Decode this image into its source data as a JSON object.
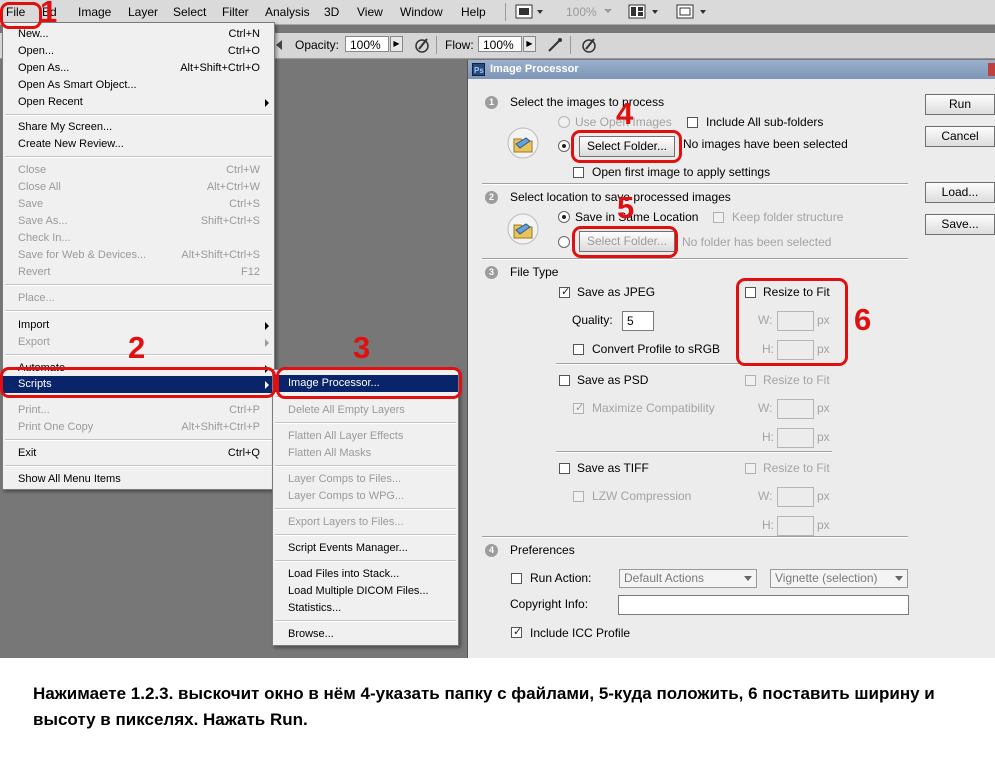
{
  "menubar": {
    "items": [
      "File",
      "Ed",
      "Image",
      "Layer",
      "Select",
      "Filter",
      "Analysis",
      "3D",
      "View",
      "Window",
      "Help"
    ],
    "zoom": "100%"
  },
  "options_bar": {
    "opacity_label": "Opacity:",
    "opacity_value": "100%",
    "flow_label": "Flow:",
    "flow_value": "100%"
  },
  "file_menu": {
    "items": [
      {
        "label": "New...",
        "shortcut": "Ctrl+N"
      },
      {
        "label": "Open...",
        "shortcut": "Ctrl+O"
      },
      {
        "label": "Open As...",
        "shortcut": "Alt+Shift+Ctrl+O"
      },
      {
        "label": "Open As Smart Object...",
        "shortcut": ""
      },
      {
        "label": "Open Recent",
        "shortcut": ""
      },
      {
        "label": "Share My Screen...",
        "shortcut": ""
      },
      {
        "label": "Create New Review...",
        "shortcut": ""
      },
      {
        "label": "Close",
        "shortcut": "Ctrl+W"
      },
      {
        "label": "Close All",
        "shortcut": "Alt+Ctrl+W"
      },
      {
        "label": "Save",
        "shortcut": "Ctrl+S"
      },
      {
        "label": "Save As...",
        "shortcut": "Shift+Ctrl+S"
      },
      {
        "label": "Check In...",
        "shortcut": ""
      },
      {
        "label": "Save for Web & Devices...",
        "shortcut": "Alt+Shift+Ctrl+S"
      },
      {
        "label": "Revert",
        "shortcut": "F12"
      },
      {
        "label": "Place...",
        "shortcut": ""
      },
      {
        "label": "Import",
        "shortcut": ""
      },
      {
        "label": "Export",
        "shortcut": ""
      },
      {
        "label": "Automate",
        "shortcut": ""
      },
      {
        "label": "Scripts",
        "shortcut": ""
      },
      {
        "label": "Print...",
        "shortcut": "Ctrl+P"
      },
      {
        "label": "Print One Copy",
        "shortcut": "Alt+Shift+Ctrl+P"
      },
      {
        "label": "Exit",
        "shortcut": "Ctrl+Q"
      },
      {
        "label": "Show All Menu Items",
        "shortcut": ""
      }
    ]
  },
  "scripts_menu": {
    "items": [
      "Image Processor...",
      "Delete All Empty Layers",
      "Flatten All Layer Effects",
      "Flatten All Masks",
      "Layer Comps to Files...",
      "Layer Comps to WPG...",
      "Export Layers to Files...",
      "Script Events Manager...",
      "Load Files into Stack...",
      "Load Multiple DICOM Files...",
      "Statistics...",
      "Browse..."
    ]
  },
  "dialog": {
    "title": "Image Processor",
    "buttons": {
      "run": "Run",
      "cancel": "Cancel",
      "load": "Load...",
      "save": "Save..."
    },
    "section1": {
      "num": "1",
      "title": "Select the images to process",
      "use_open": "Use Open Images",
      "include_sub": "Include All sub-folders",
      "select_folder": "Select Folder...",
      "status": "No images have been selected",
      "open_first": "Open first image to apply settings"
    },
    "section2": {
      "num": "2",
      "title": "Select location to save processed images",
      "same_location": "Save in Same Location",
      "keep_structure": "Keep folder structure",
      "select_folder": "Select Folder...",
      "status": "No folder has been selected"
    },
    "section3": {
      "num": "3",
      "title": "File Type",
      "jpeg": "Save as JPEG",
      "resize": "Resize to Fit",
      "quality_label": "Quality:",
      "quality_value": "5",
      "w_label": "W:",
      "h_label": "H:",
      "px": "px",
      "srgb": "Convert Profile to sRGB",
      "psd": "Save as PSD",
      "max_compat": "Maximize Compatibility",
      "tiff": "Save as TIFF",
      "lzw": "LZW Compression"
    },
    "section4": {
      "num": "4",
      "title": "Preferences",
      "run_action": "Run Action:",
      "action_set": "Default Actions",
      "action": "Vignette (selection)",
      "copyright": "Copyright Info:",
      "icc": "Include ICC Profile"
    }
  },
  "annotations": {
    "n1": "1",
    "n2": "2",
    "n3": "3",
    "n4": "4",
    "n5": "5",
    "n6": "6",
    "color": "#e01010"
  },
  "caption": "Нажимаете 1.2.3. выскочит окно в нём 4-указать папку с файлами, 5-куда положить, 6 поставить ширину и высоту в пикселях. Нажать Run."
}
